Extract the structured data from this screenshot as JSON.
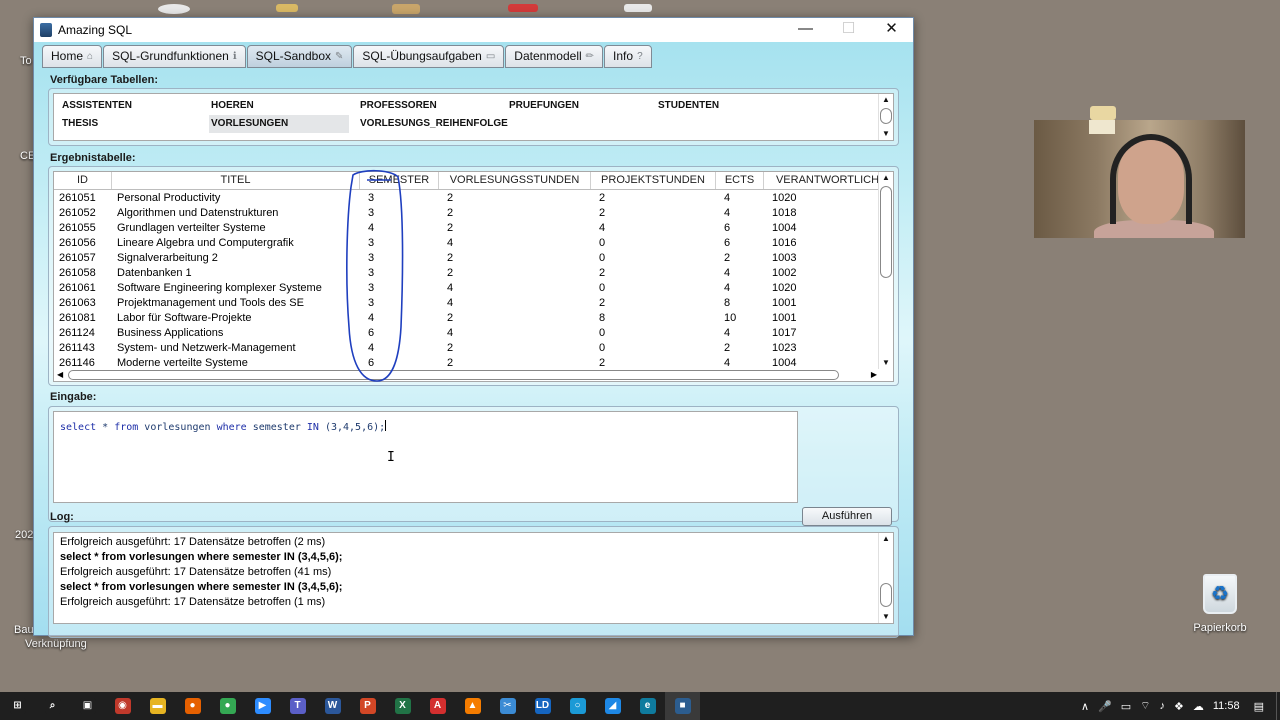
{
  "desktop": {
    "labels": [
      "To",
      "CE",
      "202",
      "Bau",
      "Verknüpfung"
    ],
    "recycle_bin": "Papierkorb"
  },
  "window": {
    "title": "Amazing SQL",
    "controls": {
      "minimize": "—",
      "maximize": "☐",
      "close": "✕"
    }
  },
  "tabs": [
    {
      "label": "Home",
      "icon": "home-icon"
    },
    {
      "label": "SQL-Grundfunktionen",
      "icon": "info-icon"
    },
    {
      "label": "SQL-Sandbox",
      "icon": "edit-icon",
      "active": true
    },
    {
      "label": "SQL-Übungsaufgaben",
      "icon": "document-icon"
    },
    {
      "label": "Datenmodell",
      "icon": "pencil-icon"
    },
    {
      "label": "Info",
      "icon": "question-icon"
    }
  ],
  "tables_section": {
    "label": "Verfügbare Tabellen:",
    "items": [
      "ASSISTENTEN",
      "HOEREN",
      "PROFESSOREN",
      "PRUEFUNGEN",
      "STUDENTEN",
      "THESIS",
      "VORLESUNGEN",
      "VORLESUNGS_REIHENFOLGE"
    ],
    "selected": "VORLESUNGEN"
  },
  "results_section": {
    "label": "Ergebnistabelle:",
    "columns": [
      "ID",
      "TITEL",
      "SEMESTER",
      "VORLESUNGSSTUNDEN",
      "PROJEKTSTUNDEN",
      "ECTS",
      "VERANTWORTLICH"
    ],
    "rows": [
      [
        "261051",
        "Personal Productivity",
        "3",
        "2",
        "2",
        "4",
        "1020"
      ],
      [
        "261052",
        "Algorithmen und Datenstrukturen",
        "3",
        "2",
        "2",
        "4",
        "1018"
      ],
      [
        "261055",
        "Grundlagen verteilter Systeme",
        "4",
        "2",
        "4",
        "6",
        "1004"
      ],
      [
        "261056",
        "Lineare Algebra und Computergrafik",
        "3",
        "4",
        "0",
        "6",
        "1016"
      ],
      [
        "261057",
        "Signalverarbeitung 2",
        "3",
        "2",
        "0",
        "2",
        "1003"
      ],
      [
        "261058",
        "Datenbanken 1",
        "3",
        "2",
        "2",
        "4",
        "1002"
      ],
      [
        "261061",
        "Software Engineering komplexer Systeme",
        "3",
        "4",
        "0",
        "4",
        "1020"
      ],
      [
        "261063",
        "Projektmanagement und Tools des SE",
        "3",
        "4",
        "2",
        "8",
        "1001"
      ],
      [
        "261081",
        "Labor für Software-Projekte",
        "4",
        "2",
        "8",
        "10",
        "1001"
      ],
      [
        "261124",
        "Business Applications",
        "6",
        "4",
        "0",
        "4",
        "1017"
      ],
      [
        "261143",
        "System- und Netzwerk-Management",
        "4",
        "2",
        "0",
        "2",
        "1023"
      ],
      [
        "261146",
        "Moderne verteilte Systeme",
        "6",
        "2",
        "2",
        "4",
        "1004"
      ]
    ]
  },
  "input_section": {
    "label": "Eingabe:",
    "query_tokens": [
      {
        "t": "select",
        "kw": true
      },
      {
        "t": " * ",
        "kw": false
      },
      {
        "t": "from",
        "kw": true
      },
      {
        "t": " vorlesungen ",
        "kw": false
      },
      {
        "t": "where",
        "kw": true
      },
      {
        "t": " semester ",
        "kw": false
      },
      {
        "t": "IN",
        "kw": true
      },
      {
        "t": " (3,4,5,6);",
        "kw": false
      }
    ],
    "run_button": "Ausführen"
  },
  "log_section": {
    "label": "Log:",
    "lines": [
      {
        "text": "Erfolgreich ausgeführt: 17 Datensätze betroffen (2 ms)",
        "bold": false
      },
      {
        "text": "select * from vorlesungen where semester IN (3,4,5,6);",
        "bold": true
      },
      {
        "text": "Erfolgreich ausgeführt: 17 Datensätze betroffen (41 ms)",
        "bold": false
      },
      {
        "text": "select * from vorlesungen where semester IN (3,4,5,6);",
        "bold": true
      },
      {
        "text": "Erfolgreich ausgeführt: 17 Datensätze betroffen (1 ms)",
        "bold": false
      }
    ]
  },
  "taskbar": {
    "apps": [
      {
        "name": "start-icon",
        "glyph": "⊞",
        "color": "#1f1f1f"
      },
      {
        "name": "search-icon",
        "glyph": "⌕",
        "color": "#1f1f1f"
      },
      {
        "name": "task-view-icon",
        "glyph": "▣",
        "color": "#1f1f1f"
      },
      {
        "name": "app-circle-icon",
        "glyph": "◉",
        "color": "#c0392b"
      },
      {
        "name": "file-explorer-icon",
        "glyph": "▬",
        "color": "#e6b422"
      },
      {
        "name": "firefox-icon",
        "glyph": "●",
        "color": "#e66000"
      },
      {
        "name": "chrome-icon",
        "glyph": "●",
        "color": "#34a853"
      },
      {
        "name": "zoom-icon",
        "glyph": "▶",
        "color": "#2d8cff"
      },
      {
        "name": "teams-icon",
        "glyph": "T",
        "color": "#5b5fc7"
      },
      {
        "name": "word-icon",
        "glyph": "W",
        "color": "#2b579a"
      },
      {
        "name": "powerpoint-icon",
        "glyph": "P",
        "color": "#d24726"
      },
      {
        "name": "excel-icon",
        "glyph": "X",
        "color": "#217346"
      },
      {
        "name": "acrobat-icon",
        "glyph": "A",
        "color": "#d32f2f"
      },
      {
        "name": "vlc-icon",
        "glyph": "▲",
        "color": "#f57c00"
      },
      {
        "name": "snipping-icon",
        "glyph": "✂",
        "color": "#3b8bd4"
      },
      {
        "name": "ld-icon",
        "glyph": "LD",
        "color": "#1565c0"
      },
      {
        "name": "webex-icon",
        "glyph": "○",
        "color": "#1b9ad6"
      },
      {
        "name": "draw-icon",
        "glyph": "◢",
        "color": "#1e88e5"
      },
      {
        "name": "edge-icon",
        "glyph": "e",
        "color": "#0f7b9e"
      },
      {
        "name": "amazing-sql-icon",
        "glyph": "■",
        "color": "#2c5d8f"
      }
    ],
    "tray": {
      "time": "11:58"
    }
  }
}
